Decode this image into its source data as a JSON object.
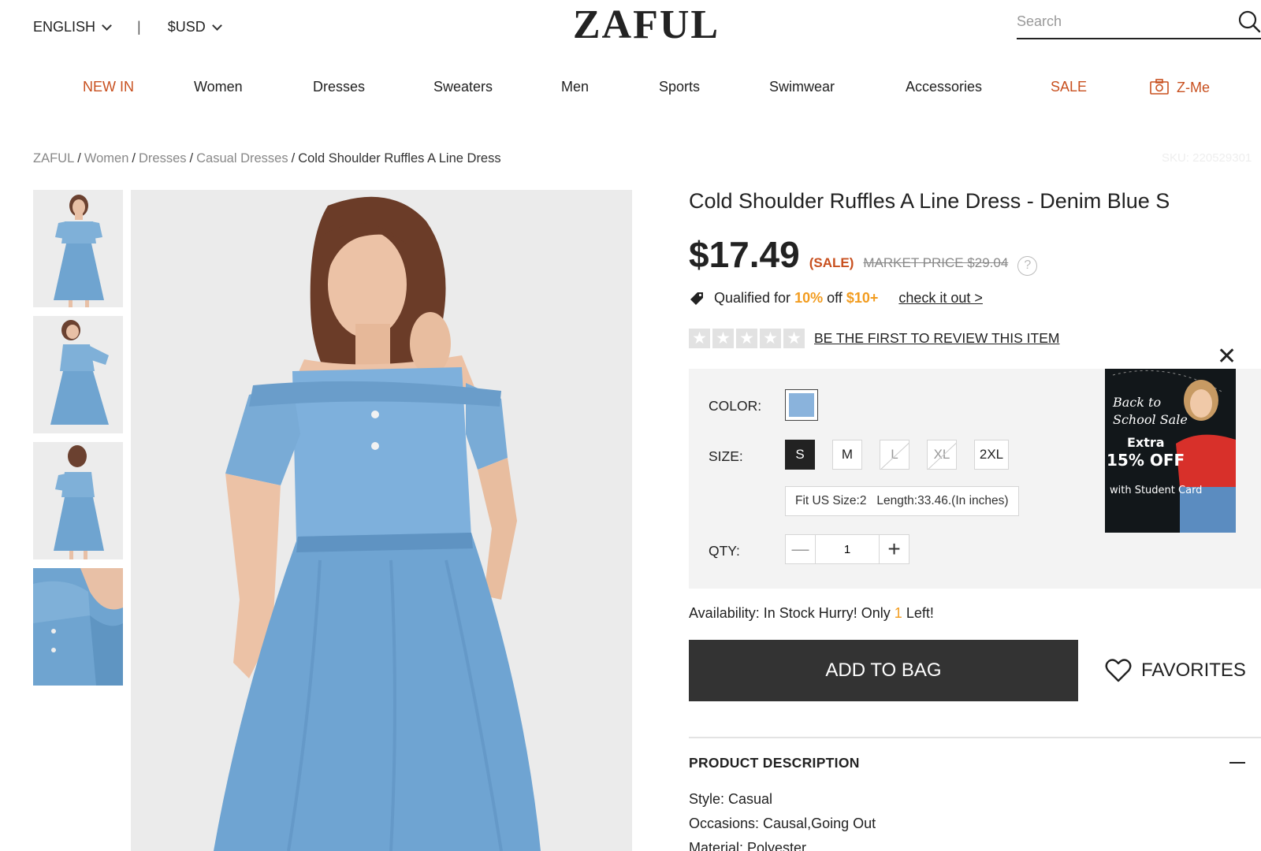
{
  "header": {
    "language": "ENGLISH",
    "currency": "$USD",
    "logo": "ZAFUL",
    "search_placeholder": "Search"
  },
  "nav": {
    "new_in": "NEW IN",
    "women": "Women",
    "dresses": "Dresses",
    "sweaters": "Sweaters",
    "men": "Men",
    "sports": "Sports",
    "swimwear": "Swimwear",
    "accessories": "Accessories",
    "sale": "SALE",
    "zme": "Z-Me"
  },
  "breadcrumb": {
    "items": [
      "ZAFUL",
      "Women",
      "Dresses",
      "Casual Dresses"
    ],
    "current": "Cold Shoulder Ruffles A Line Dress"
  },
  "sku": "SKU: 220529301",
  "product": {
    "title": "Cold Shoulder Ruffles A Line Dress - Denim Blue S",
    "price": "$17.49",
    "sale_label": "(SALE)",
    "market_price": "MARKET PRICE $29.04",
    "help": "?",
    "promo": {
      "prefix": "Qualified for",
      "percent": "10%",
      "middle": "off",
      "threshold": "$10+",
      "link": "check it out >"
    },
    "rating_stars": 0,
    "review_link": "BE THE FIRST TO REVIEW THIS ITEM",
    "color_label": "COLOR:",
    "color_swatch": "#8ab3dc",
    "size_label": "SIZE:",
    "sizes": [
      "S",
      "M",
      "L",
      "XL",
      "2XL"
    ],
    "selected_size": "S",
    "fit_text": "Fit US Size:2   Length:33.46.(In inches)",
    "qty_label": "QTY:",
    "qty_value": "1",
    "availability_prefix": "Availability: In Stock Hurry! Only",
    "availability_count": "1",
    "availability_suffix": "Left!",
    "add_to_bag": "ADD TO BAG",
    "favorites": "FAVORITES"
  },
  "banner": {
    "line1": "Back to",
    "line2": "School Sale",
    "line3": "Extra",
    "line4": "15% OFF",
    "line5": "with Student Card"
  },
  "description": {
    "heading": "PRODUCT DESCRIPTION",
    "lines": [
      "Style: Casual",
      "Occasions: Causal,Going Out",
      "Material: Polyester"
    ]
  },
  "colors": {
    "accent_orange": "#c8501f",
    "highlight_yellow": "#f29c1f",
    "dark_button": "#333333",
    "denim_blue": "#8ab3dc"
  }
}
